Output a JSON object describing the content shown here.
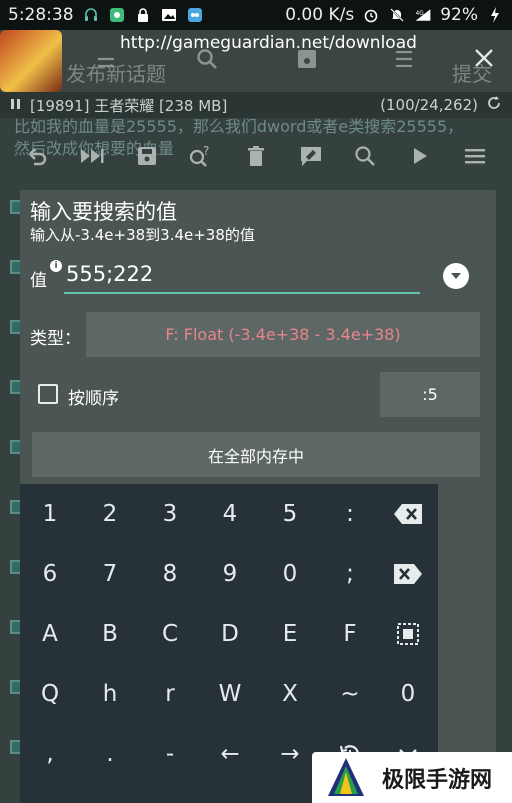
{
  "status_bar": {
    "time": "5:28:38",
    "network_speed": "0.00 K/s",
    "network_type": "4G",
    "battery": "92%"
  },
  "app_header": {
    "url": "http://gameguardian.net/download",
    "title": "发布新话题",
    "submit_label": "提交"
  },
  "process_bar": {
    "process": "[19891] 王者荣耀 [238 MB]",
    "count": "(100/24,262)"
  },
  "hint_text": "比如我的血量是25555，那么我们dword或者e类搜索25555，然后改成你想要的血量",
  "dialog": {
    "title": "输入要搜索的值",
    "subtitle": "输入从-3.4e+38到3.4e+38的值",
    "value_label": "值",
    "value": "555;222",
    "type_label": "类型：",
    "type_value": "F: Float (-3.4e+38 - 3.4e+38)",
    "order_label": "按顺序",
    "order_value": ":5",
    "search_all_label": "在全部内存中"
  },
  "keyboard": {
    "rows": [
      [
        "1",
        "2",
        "3",
        "4",
        "5",
        ":"
      ],
      [
        "6",
        "7",
        "8",
        "9",
        "0",
        ";"
      ],
      [
        "A",
        "B",
        "C",
        "D",
        "E",
        "F"
      ],
      [
        "Q",
        "h",
        "r",
        "W",
        "X",
        "~",
        "0"
      ],
      [
        ",",
        ".",
        "-",
        "←",
        "→"
      ]
    ]
  },
  "watermark": {
    "text": "极限手游网"
  },
  "colors": {
    "accent": "#62c2b0",
    "type_value": "#e8858a",
    "dialog_bg": "#4b5553",
    "keyboard_bg": "#263238"
  }
}
